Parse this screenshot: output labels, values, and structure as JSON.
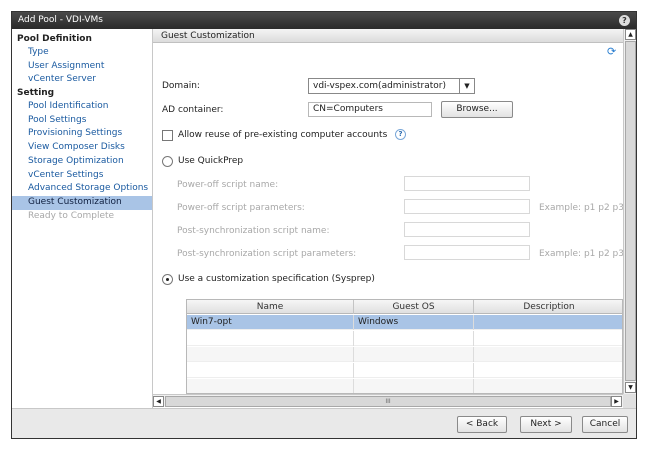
{
  "window": {
    "title": "Add Pool - VDI-VMs"
  },
  "icons": {
    "help": "help-icon",
    "refresh": "refresh-icon",
    "info": "info-icon"
  },
  "sidebar": {
    "pool_definition": "Pool Definition",
    "pool_items": [
      "Type",
      "User Assignment",
      "vCenter Server"
    ],
    "setting": "Setting",
    "setting_items": [
      "Pool Identification",
      "Pool Settings",
      "Provisioning Settings",
      "View Composer Disks",
      "Storage Optimization",
      "vCenter Settings",
      "Advanced Storage Options",
      "Guest Customization",
      "Ready to Complete"
    ],
    "active_item": "Guest Customization",
    "disabled_item": "Ready to Complete"
  },
  "main": {
    "section_title": "Guest Customization",
    "domain": {
      "label": "Domain:",
      "value": "vdi-vspex.com(administrator)"
    },
    "ad_container": {
      "label": "AD container:",
      "value": "CN=Computers",
      "browse_label": "Browse..."
    },
    "allow_reuse": {
      "label": "Allow reuse of pre-existing computer accounts",
      "checked": false
    },
    "quickprep": {
      "label": "Use QuickPrep",
      "selected": false,
      "poweroff_script_name": "Power-off script name:",
      "poweroff_script_params": "Power-off script parameters:",
      "postsync_script_name": "Post-synchronization script name:",
      "postsync_script_params": "Post-synchronization script parameters:",
      "example1": "Example: p1 p2 p3",
      "example2": "Example: p1 p2 p3"
    },
    "sysprep": {
      "label": "Use a customization specification (Sysprep)",
      "selected": true,
      "columns": {
        "name": "Name",
        "guest_os": "Guest OS",
        "description": "Description"
      },
      "rows": [
        {
          "name": "Win7-opt",
          "guest_os": "Windows",
          "description": ""
        }
      ]
    },
    "hscroll_mark": "III"
  },
  "footer": {
    "back": "< Back",
    "next": "Next >",
    "cancel": "Cancel"
  }
}
